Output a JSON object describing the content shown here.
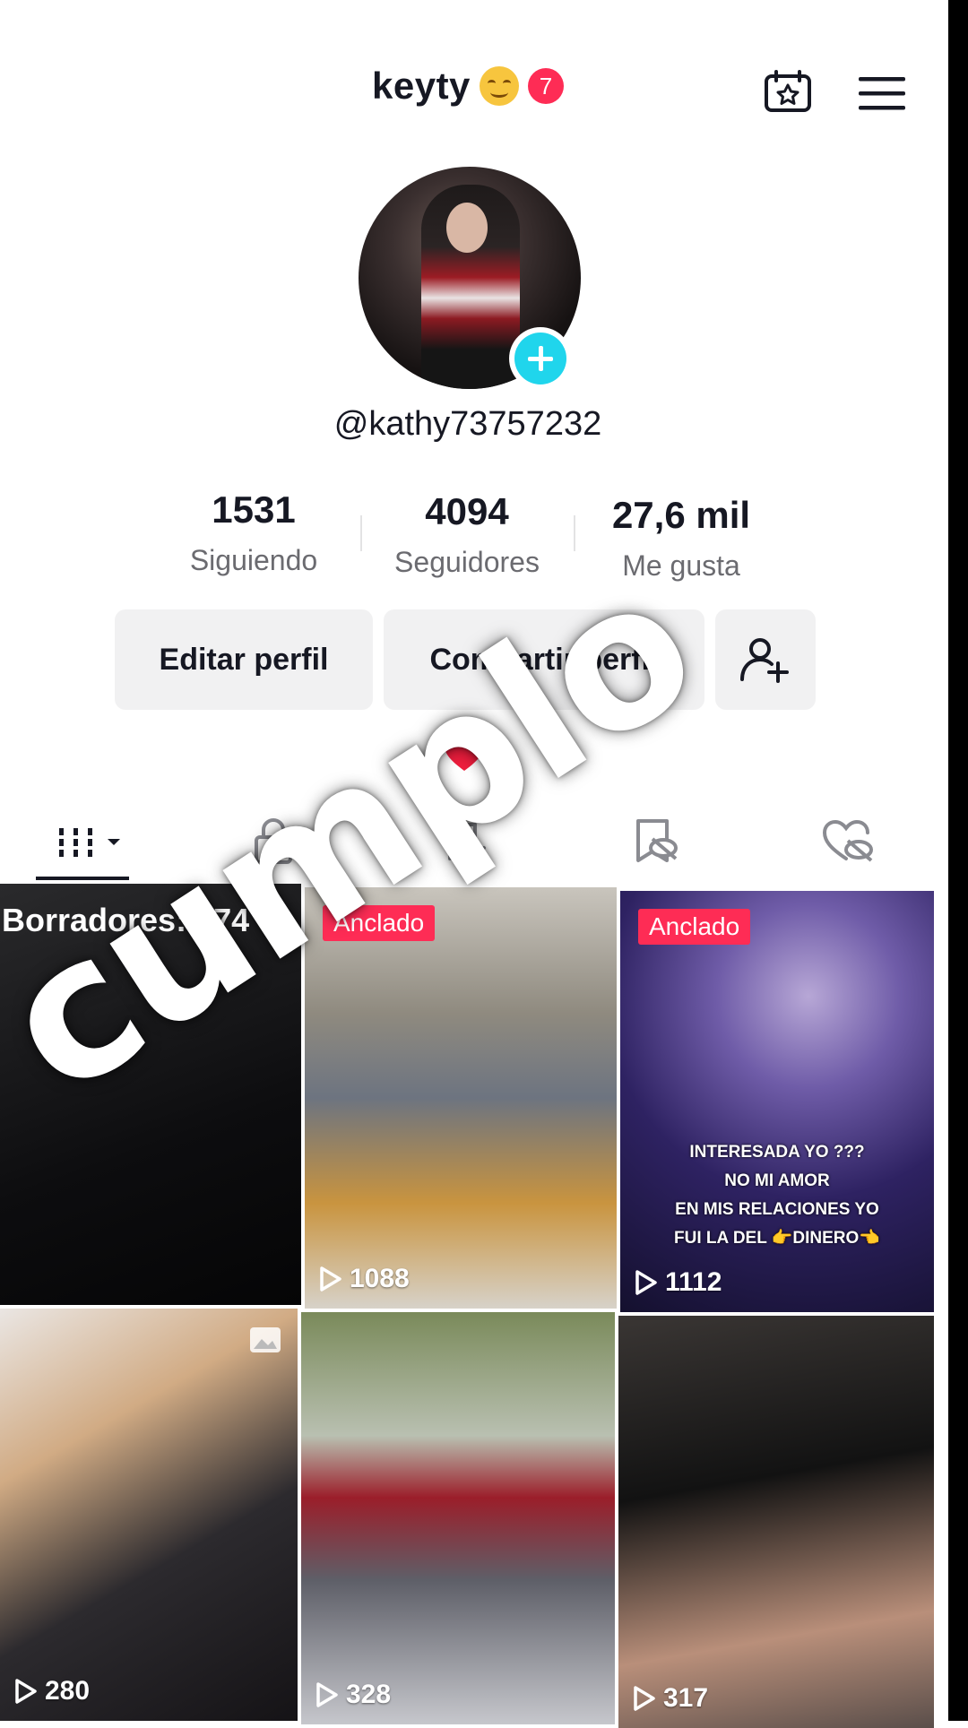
{
  "header": {
    "title": "keyty",
    "notification_count": "7",
    "icons": [
      "calendar-star-icon",
      "menu-icon"
    ]
  },
  "profile": {
    "username": "@kathy73757232",
    "stats": [
      {
        "value": "1531",
        "label": "Siguiendo"
      },
      {
        "value": "4094",
        "label": "Seguidores"
      },
      {
        "value": "27,6 mil",
        "label": "Me gusta"
      }
    ],
    "buttons": {
      "edit": "Editar perfil",
      "share": "Compartir perfil"
    },
    "bio_emoji": "heart"
  },
  "tabs": [
    "videos-tab",
    "private-tab",
    "reposts-tab",
    "favorites-tab",
    "liked-tab"
  ],
  "grid": {
    "drafts_label": "Borradores: 474",
    "pinned_label": "Anclado",
    "videos": [
      {
        "views": "1088",
        "pinned": true
      },
      {
        "views": "1112",
        "pinned": true,
        "caption": [
          "INTERESADA YO ???",
          "NO MI AMOR",
          "EN MIS RELACIONES YO",
          "FUI LA DEL 👉DINERO👈"
        ]
      },
      {
        "views": "280"
      },
      {
        "views": "328"
      },
      {
        "views": "317"
      }
    ]
  },
  "overlay_text": "cumplo",
  "colors": {
    "accent": "#fe2c55",
    "add": "#20d5ec"
  }
}
